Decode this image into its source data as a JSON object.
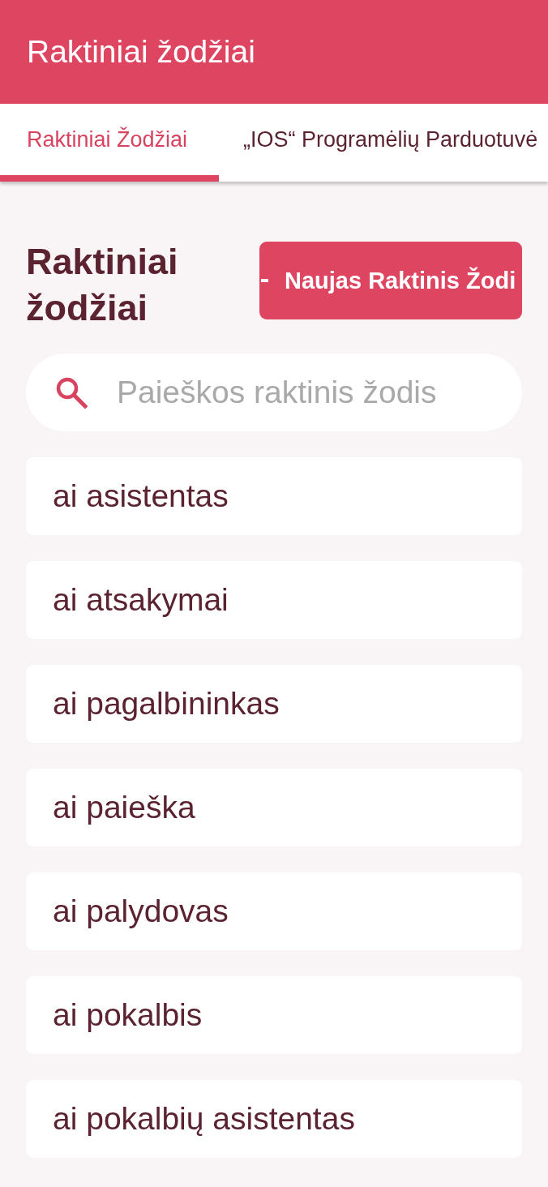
{
  "app_bar": {
    "title": "Raktiniai žodžiai"
  },
  "tabs": [
    {
      "label": "Raktiniai Žodžiai",
      "selected": true
    },
    {
      "label": "„IOS“ Programėlių Parduotuvė",
      "selected": false
    }
  ],
  "page": {
    "heading": "Raktiniai žodžiai",
    "new_button": {
      "label": "Naujas Raktinis Žodi"
    }
  },
  "search": {
    "placeholder": "Paieškos raktinis žodis"
  },
  "keywords": [
    "ai asistentas",
    "ai atsakymai",
    "ai pagalbininkas",
    "ai paieška",
    "ai palydovas",
    "ai pokalbis",
    "ai pokalbių asistentas"
  ]
}
